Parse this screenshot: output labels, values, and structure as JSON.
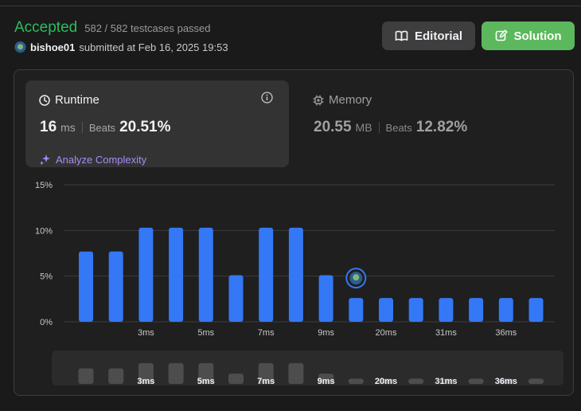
{
  "submission": {
    "status": "Accepted",
    "testcases": "582 / 582 testcases passed",
    "username": "bishoe01",
    "submitted_at": "submitted at Feb 16, 2025 19:53"
  },
  "buttons": {
    "editorial": "Editorial",
    "solution": "Solution"
  },
  "runtime": {
    "title": "Runtime",
    "value": "16",
    "unit": "ms",
    "beats_label": "Beats",
    "beats_pct": "20.51%",
    "analyze_label": "Analyze Complexity"
  },
  "memory": {
    "title": "Memory",
    "value": "20.55",
    "unit": "MB",
    "beats_label": "Beats",
    "beats_pct": "12.82%"
  },
  "colors": {
    "accepted": "#2cbb5d",
    "bar": "#3478f6",
    "solution_button": "#5cb85c",
    "analyze": "#a78bfa"
  },
  "chart_data": {
    "type": "bar",
    "title": "",
    "xlabel": "",
    "ylabel": "",
    "ylim": [
      0,
      15
    ],
    "y_ticks": [
      "0%",
      "5%",
      "10%",
      "15%"
    ],
    "x_tick_labels": [
      "3ms",
      "5ms",
      "7ms",
      "9ms",
      "20ms",
      "31ms",
      "36ms"
    ],
    "values": [
      7.7,
      7.7,
      10.3,
      10.3,
      10.3,
      5.1,
      10.3,
      10.3,
      5.1,
      2.6,
      2.6,
      2.6,
      2.6,
      2.6,
      2.6,
      2.6
    ],
    "user_bar_index": 9,
    "grid": true
  }
}
